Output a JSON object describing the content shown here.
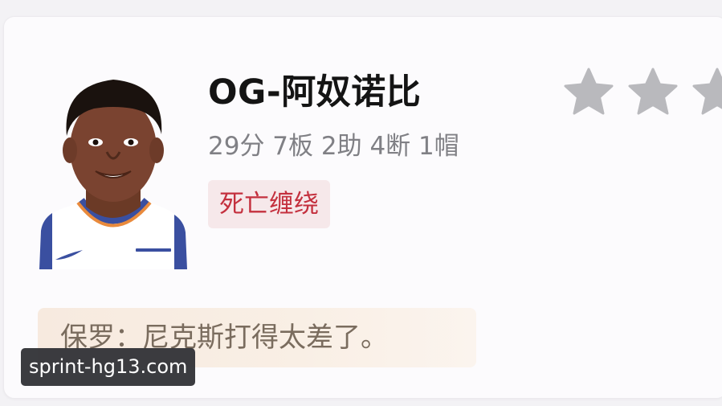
{
  "player": {
    "name": "OG-阿奴诺比",
    "stats": "29分 7板 2助 4断 1帽",
    "tag": "死亡缠绕",
    "rating": {
      "stars_visible": 3,
      "filled": 0
    }
  },
  "quote": {
    "text": "保罗：尼克斯打得太差了。"
  },
  "watermark": {
    "text": "sprint-hg13.com"
  },
  "colors": {
    "tag_text": "#c4303e",
    "tag_bg": "#f6e8ea",
    "star": "#b9b9bd",
    "jersey_trim": "#3a4fa0",
    "jersey_orange": "#e98a3c"
  },
  "icons": [
    "star-icon",
    "player-avatar"
  ]
}
